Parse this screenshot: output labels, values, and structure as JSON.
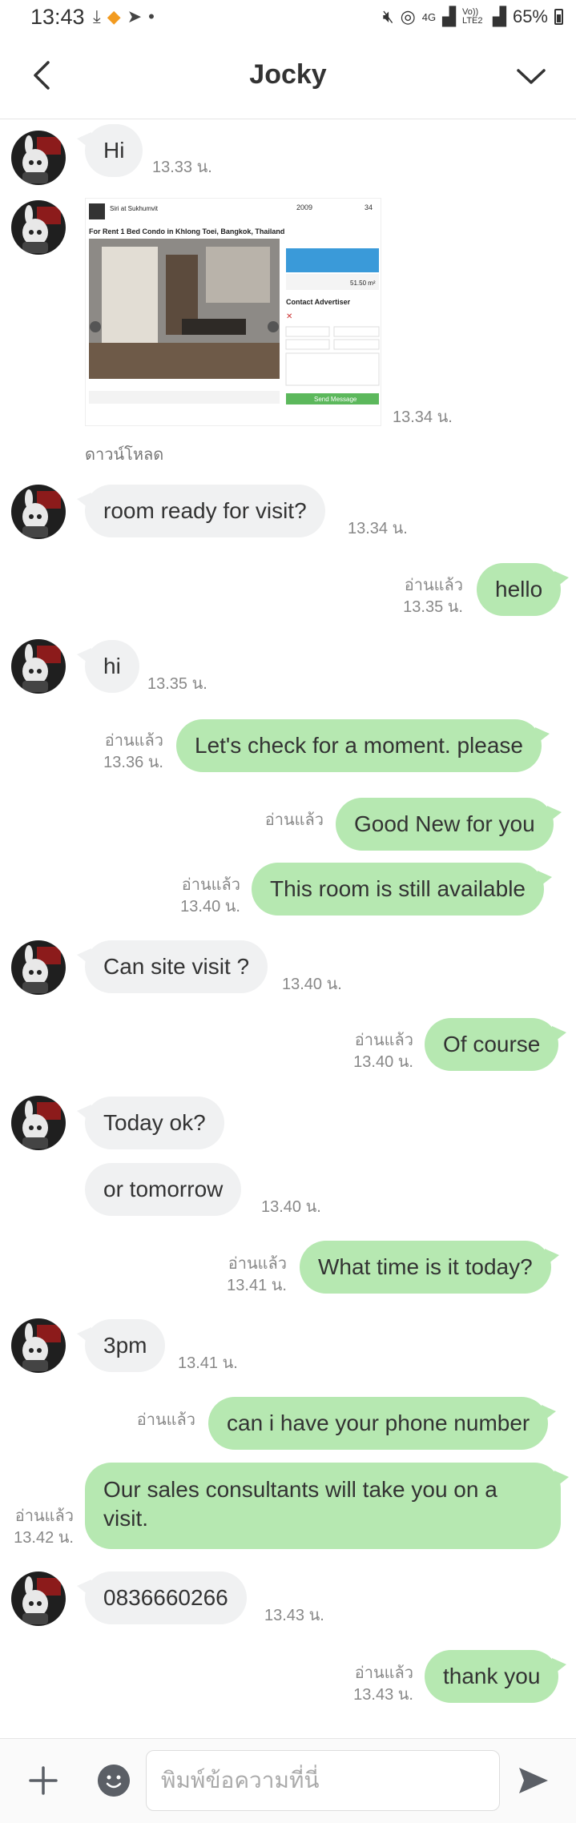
{
  "status_bar": {
    "time": "13:43",
    "battery": "65%",
    "network": "4G",
    "volte": "Vo)) LTE2"
  },
  "header": {
    "title": "Jocky"
  },
  "shared_image": {
    "download_label": "ดาวน์โหลด",
    "listing_name": "Siri at Sukhumvit",
    "listing_title": "For Rent 1 Bed Condo in Khlong Toei, Bangkok, Thailand",
    "year": "2009",
    "floors": "34",
    "size": "51.50 m²",
    "contact_heading": "Contact Advertiser",
    "send_button": "Send Message"
  },
  "messages": [
    {
      "id": "m1",
      "text": "Hi",
      "time": "13.33 น."
    },
    {
      "id": "m2",
      "text": "",
      "time": "13.34 น."
    },
    {
      "id": "m3",
      "text": "room ready for visit?",
      "time": "13.34 น."
    },
    {
      "id": "m4",
      "text": "hello",
      "read": "อ่านแล้ว",
      "time": "13.35 น."
    },
    {
      "id": "m5",
      "text": "hi",
      "time": "13.35 น."
    },
    {
      "id": "m6",
      "text": "Let's check for a moment. please",
      "read": "อ่านแล้ว",
      "time": "13.36 น."
    },
    {
      "id": "m7",
      "text": "Good New for you",
      "read": "อ่านแล้ว"
    },
    {
      "id": "m8",
      "text": "This room is still available",
      "read": "อ่านแล้ว",
      "time": "13.40 น."
    },
    {
      "id": "m9",
      "text": "Can site visit ?",
      "time": "13.40 น."
    },
    {
      "id": "m10",
      "text": "Of course",
      "read": "อ่านแล้ว",
      "time": "13.40 น."
    },
    {
      "id": "m11",
      "text": "Today ok?"
    },
    {
      "id": "m12",
      "text": "or tomorrow",
      "time": "13.40 น."
    },
    {
      "id": "m13",
      "text": "What time is it today?",
      "read": "อ่านแล้ว",
      "time": "13.41 น."
    },
    {
      "id": "m14",
      "text": "3pm",
      "time": "13.41 น."
    },
    {
      "id": "m15",
      "text": "can i have your phone number",
      "read": "อ่านแล้ว"
    },
    {
      "id": "m16",
      "text": "Our sales consultants will take you on a visit.",
      "read": "อ่านแล้ว",
      "time": "13.42 น."
    },
    {
      "id": "m17",
      "text": "0836660266",
      "time": "13.43 น."
    },
    {
      "id": "m18",
      "text": "thank you",
      "read": "อ่านแล้ว",
      "time": "13.43 น."
    }
  ],
  "composer": {
    "placeholder": "พิมพ์ข้อความที่นี่"
  },
  "colors": {
    "outgoing_bubble": "#b6e8b1",
    "incoming_bubble": "#f0f1f2",
    "send_icon": "#5b5f66"
  }
}
